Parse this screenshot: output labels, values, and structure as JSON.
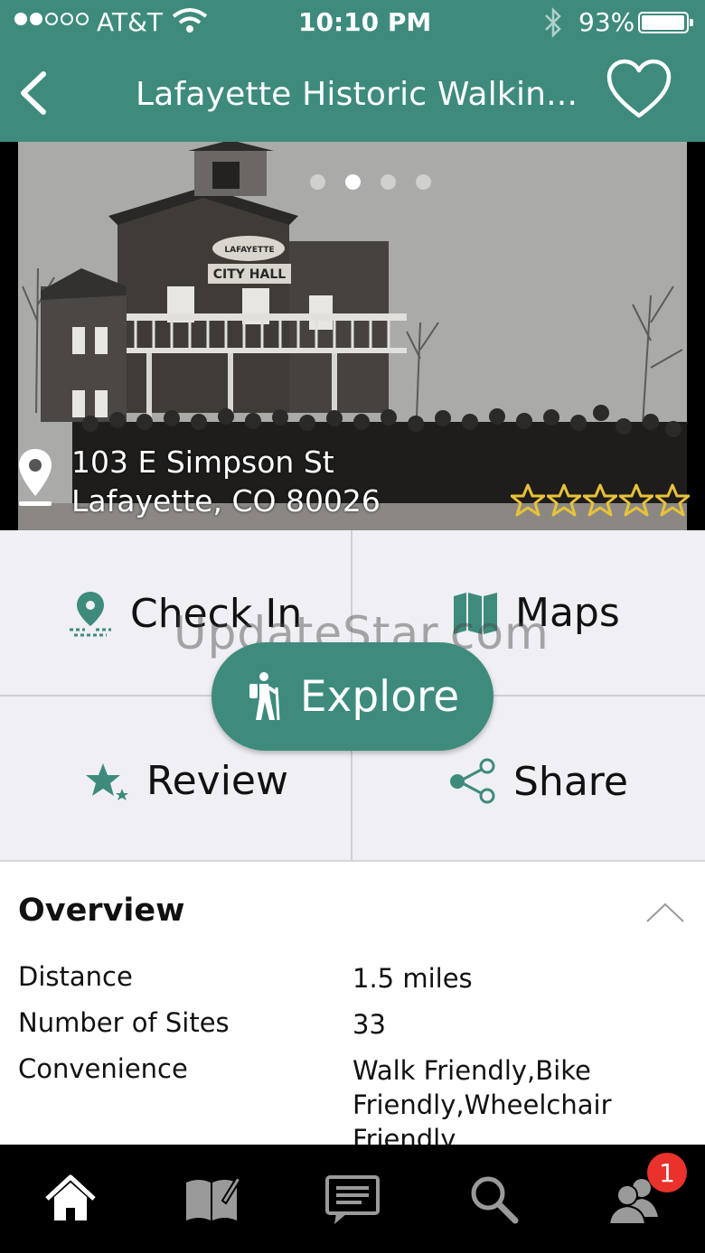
{
  "status_bar": {
    "carrier": "AT&T",
    "time": "10:10 PM",
    "battery": "93%"
  },
  "header": {
    "title": "Lafayette Historic Walkin..."
  },
  "hero": {
    "address_line1": "103 E Simpson St",
    "address_line2": "Lafayette, CO 80026",
    "carousel_pages": 4,
    "carousel_active": 2,
    "rating": 0,
    "rating_max": 5,
    "sign_text": "CITY HALL",
    "sign_top_text": "LAFAYETTE"
  },
  "actions": {
    "check_in": "Check In",
    "maps": "Maps",
    "explore": "Explore",
    "review": "Review",
    "share": "Share"
  },
  "watermark": "UpdateStar.com",
  "overview": {
    "title": "Overview",
    "distance_label": "Distance",
    "distance_value": "1.5 miles",
    "sites_label": "Number of Sites",
    "sites_value": "33",
    "convenience_label": "Convenience",
    "convenience_value": "Walk Friendly,Bike Friendly,Wheelchair Friendly"
  },
  "tab_bar": {
    "badge_count": "1"
  },
  "colors": {
    "accent": "#3e8b7d",
    "badge": "#e8322b",
    "star": "#e8c23a"
  },
  "icons": [
    "back-chevron-icon",
    "heart-icon",
    "location-pin-icon",
    "star-icon",
    "checkin-pin-icon",
    "map-icon",
    "hiker-icon",
    "review-star-icon",
    "share-icon",
    "collapse-chevron-icon",
    "home-icon",
    "book-icon",
    "chat-icon",
    "search-icon",
    "friends-icon"
  ]
}
